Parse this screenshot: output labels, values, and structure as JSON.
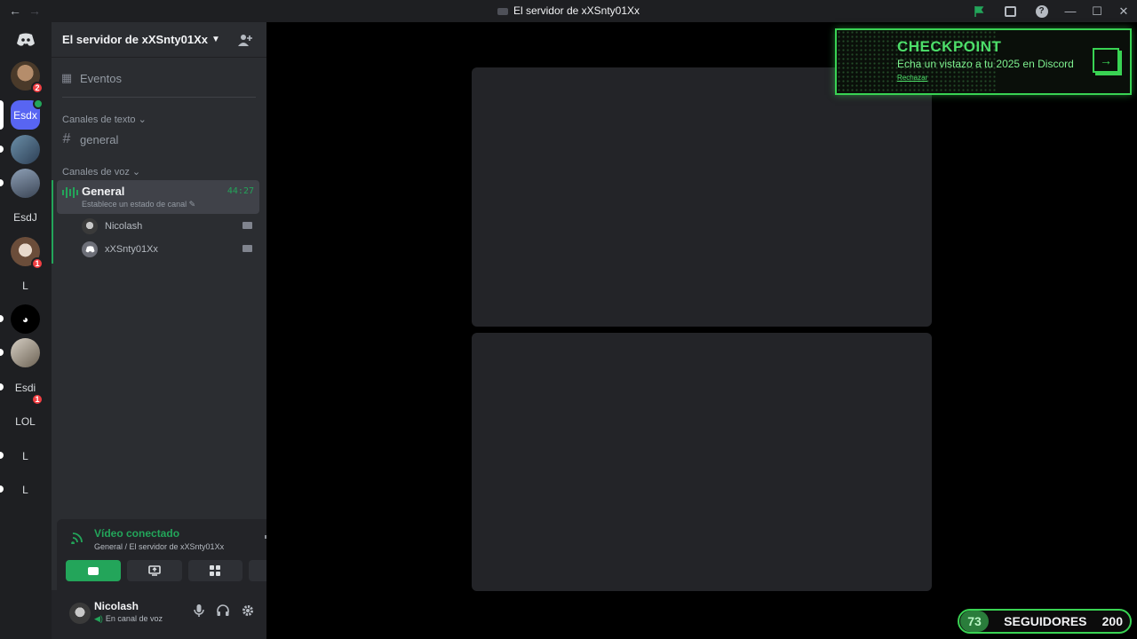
{
  "titlebar": {
    "title": "El servidor de xXSnty01Xx",
    "back_glyph": "←",
    "forward_glyph": "→",
    "help_glyph": "?",
    "minimize_glyph": "—",
    "maximize_glyph": "☐",
    "close_glyph": "✕"
  },
  "rail": {
    "servers": [
      {
        "label": "",
        "badge": "2",
        "style": "avatar-a"
      },
      {
        "label": "Esdx",
        "badge": "",
        "style": "blurple"
      },
      {
        "label": "",
        "badge": "",
        "style": "avatar-b"
      },
      {
        "label": "",
        "badge": "",
        "style": "avatar-c"
      },
      {
        "label": "EsdJ",
        "badge": "",
        "style": "text"
      },
      {
        "label": "",
        "badge": "1",
        "style": "avatar-d"
      },
      {
        "label": "L",
        "badge": "",
        "style": "text"
      },
      {
        "label": "◕",
        "badge": "",
        "style": "avatar-e"
      },
      {
        "label": "",
        "badge": "",
        "style": "avatar-f"
      },
      {
        "label": "Esdi",
        "badge": "1",
        "style": "text"
      },
      {
        "label": "LOL",
        "badge": "",
        "style": "text"
      },
      {
        "label": "L",
        "badge": "",
        "style": "text"
      },
      {
        "label": "L",
        "badge": "",
        "style": "text"
      }
    ]
  },
  "sidebar": {
    "server_name": "El servidor de xXSnty01Xx",
    "events_label": "Eventos",
    "text_category": "Canales de texto",
    "text_channel": "general",
    "voice_category": "Canales de voz",
    "voice_channel": "General",
    "voice_status": "Establece un estado de canal",
    "voice_timer": "44:27",
    "members": [
      "Nicolash",
      "xXSnty01Xx"
    ]
  },
  "voice_panel": {
    "title": "Vídeo conectado",
    "subtitle": "General / El servidor de xXSnty01Xx"
  },
  "user": {
    "name": "Nicolash",
    "status": "En canal de voz"
  },
  "checkpoint": {
    "title": "CHECKPOINT",
    "subtitle": "Echa un vistazo a tu 2025 en Discord",
    "dismiss": "Rechazar",
    "arrow_glyph": "→"
  },
  "followers": {
    "current": "73",
    "label": "SEGUIDORES",
    "goal": "200"
  },
  "colors": {
    "accent_green": "#23a55a",
    "blurple": "#5865f2",
    "checkpoint_green": "#39d353"
  }
}
